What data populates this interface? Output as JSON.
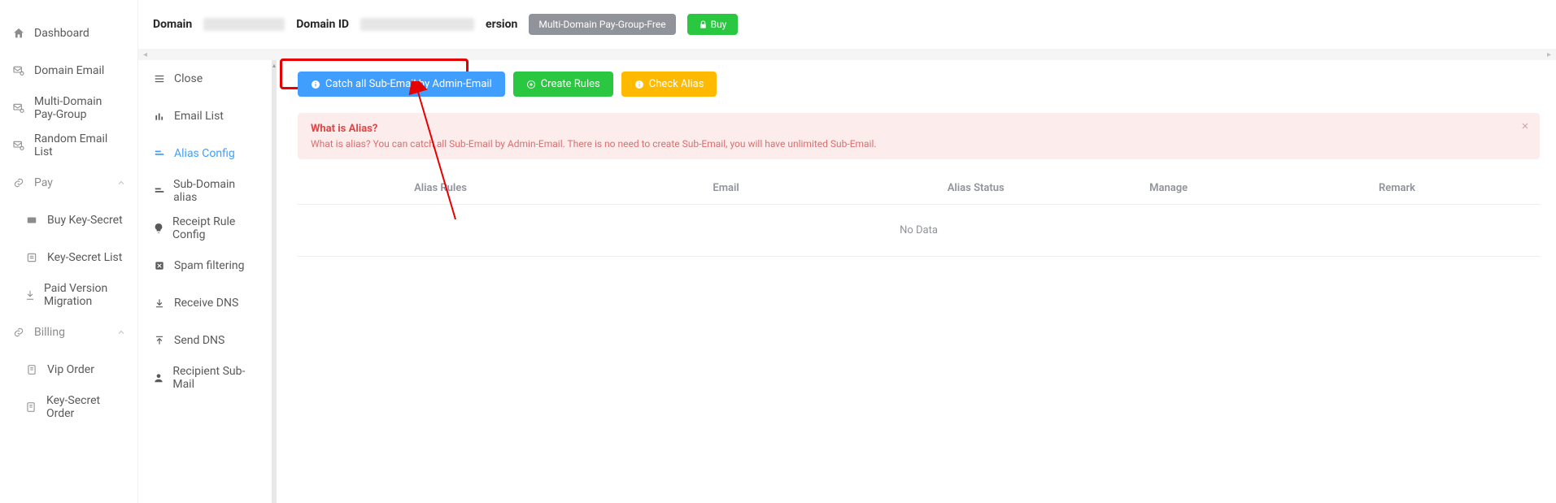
{
  "sidebar": {
    "items": [
      {
        "label": "Dashboard",
        "icon": "home-icon"
      },
      {
        "label": "Domain Email",
        "icon": "mail-config-icon"
      },
      {
        "label": "Multi-Domain Pay-Group",
        "icon": "group-icon"
      },
      {
        "label": "Random Email List",
        "icon": "random-icon"
      }
    ],
    "pay_group": {
      "label": "Pay",
      "items": [
        {
          "label": "Buy Key-Secret"
        },
        {
          "label": "Key-Secret List"
        },
        {
          "label": "Paid Version Migration"
        }
      ]
    },
    "billing_group": {
      "label": "Billing",
      "items": [
        {
          "label": "Vip Order"
        },
        {
          "label": "Key-Secret Order"
        }
      ]
    }
  },
  "header": {
    "domain_label": "Domain",
    "domain_id_label": "Domain ID",
    "version_label": "ersion",
    "version_badge": "Multi-Domain Pay-Group-Free",
    "buy_label": "Buy"
  },
  "mid_sidebar": {
    "items": [
      {
        "label": "Close"
      },
      {
        "label": "Email List"
      },
      {
        "label": "Alias Config",
        "active": true
      },
      {
        "label": "Sub-Domain alias"
      },
      {
        "label": "Receipt Rule Config"
      },
      {
        "label": "Spam filtering"
      },
      {
        "label": "Receive DNS"
      },
      {
        "label": "Send DNS"
      },
      {
        "label": "Recipient Sub-Mail"
      }
    ]
  },
  "actions": {
    "catch_all": "Catch all Sub-Email by Admin-Email",
    "create_rules": "Create Rules",
    "check_alias": "Check Alias"
  },
  "alert": {
    "title": "What is Alias?",
    "body": "What is alias? You can catch all Sub-Email by Admin-Email. There is no need to create Sub-Email, you will have unlimited Sub-Email."
  },
  "table": {
    "headers": {
      "rules": "Alias Rules",
      "email": "Email",
      "status": "Alias Status",
      "manage": "Manage",
      "remark": "Remark"
    },
    "no_data": "No Data"
  }
}
